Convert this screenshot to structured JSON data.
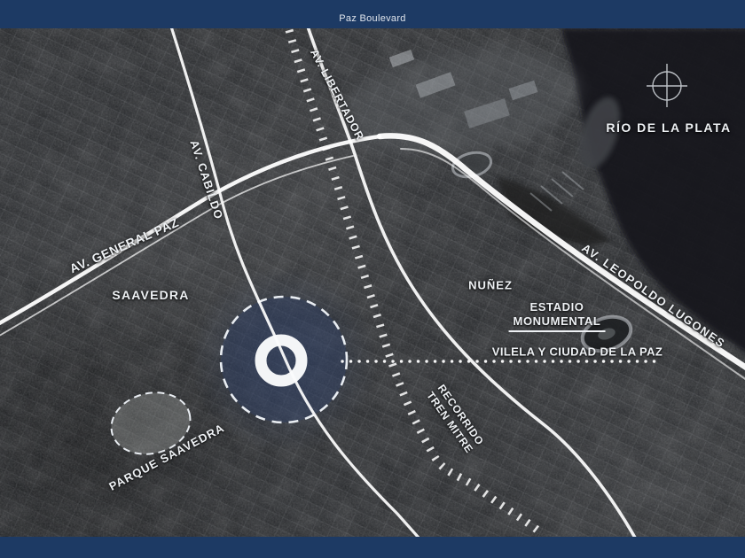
{
  "slide": {
    "title": "Paz Boulevard",
    "border_color": "#1d3a64"
  },
  "map": {
    "type": "annotated-satellite-map",
    "roads": {
      "av_general_paz": "AV. GENERAL PAZ",
      "av_cabildo": "AV. CABILDO",
      "av_libertador": "AV. LIBERTADOR",
      "av_leopoldo_lugones": "AV. LEOPOLDO LUGONES"
    },
    "places": {
      "rio_de_la_plata": "RÍO DE LA PLATA",
      "saavedra": "SAAVEDRA",
      "nunez": "NUÑEZ",
      "estadio_line1": "ESTADIO",
      "estadio_line2": "MONUMENTAL",
      "vilela": "VILELA Y CIUDAD DE LA PAZ",
      "parque_saavedra": "PARQUE SAAVEDRA"
    },
    "rail": {
      "line1": "RECORRIDO",
      "line2": "TREN MITRE"
    },
    "icons": {
      "compass": "compass-crosshair-icon"
    },
    "colors": {
      "border": "#1d3a64",
      "road": "#ffffff",
      "label": "#eef1f4",
      "site_highlight_fill": "#2f426a",
      "water": "#17191c"
    }
  }
}
